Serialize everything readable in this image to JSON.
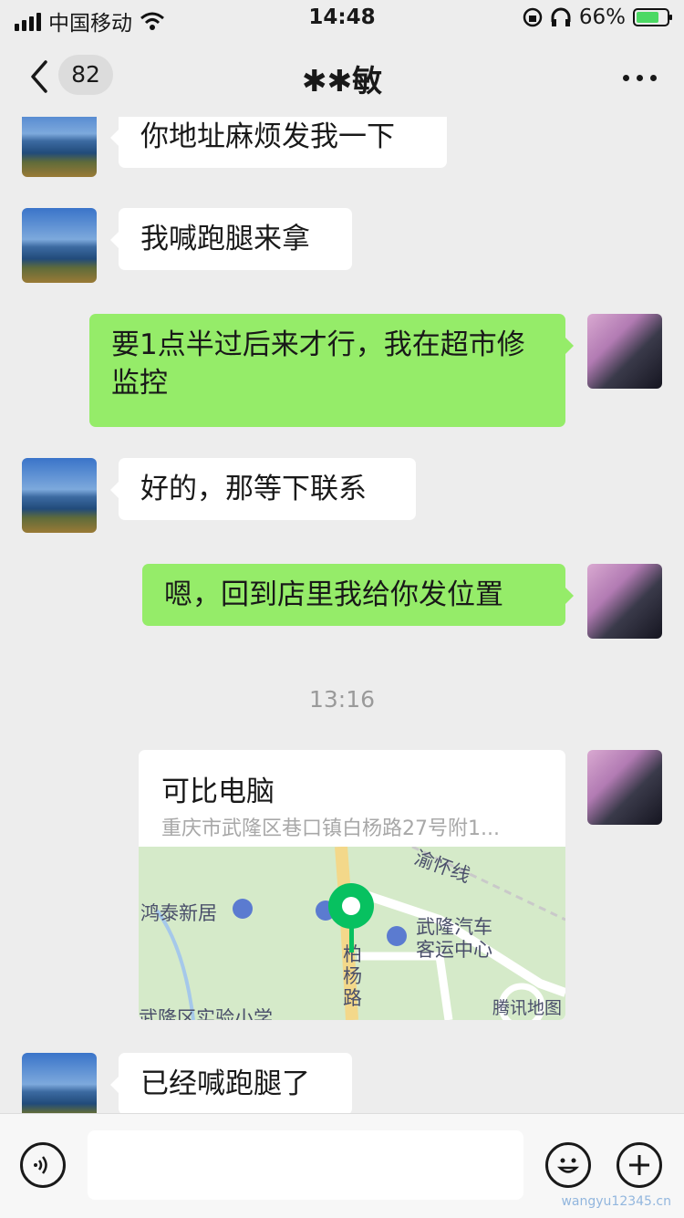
{
  "status_bar": {
    "carrier": "中国移动",
    "time": "14:48",
    "battery": "66%"
  },
  "navbar": {
    "back_count": "82",
    "title": "✱✱敏"
  },
  "messages": [
    {
      "from": "them",
      "text": "你地址麻烦发我一下"
    },
    {
      "from": "them",
      "text": "我喊跑腿来拿"
    },
    {
      "from": "me",
      "text": "要1点半过后来才行，我在超市修监控"
    },
    {
      "from": "them",
      "text": "好的，那等下联系"
    },
    {
      "from": "me",
      "text": "嗯，回到店里我给你发位置"
    },
    {
      "from": "them",
      "text": "已经喊跑腿了"
    }
  ],
  "timestamp": "13:16",
  "location_card": {
    "name": "可比电脑",
    "address": "重庆市武隆区巷口镇白杨路27号附1...",
    "map_labels": {
      "rail": "渝怀线",
      "place1": "鸿泰新居",
      "station_line1": "武隆汽车",
      "station_line2": "客运中心",
      "road": "柏杨路",
      "school": "武隆区实验小学",
      "provider": "腾讯地图"
    }
  },
  "watermark": "wangyu12345.cn",
  "icons": [
    "back-chevron-icon",
    "more-icon",
    "voice-icon",
    "emoji-icon",
    "plus-icon",
    "wifi-icon",
    "headphones-icon",
    "lock-rotation-icon",
    "battery-icon"
  ]
}
